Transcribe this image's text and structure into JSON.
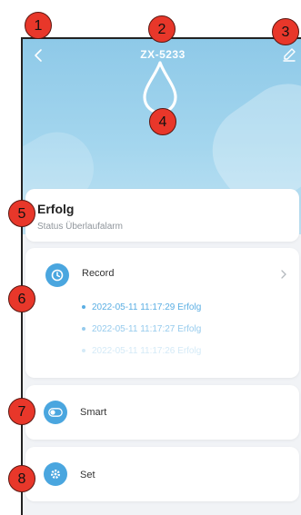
{
  "header": {
    "title": "ZX-5233"
  },
  "status": {
    "title": "Erfolg",
    "subtitle": "Status Überlaufalarm"
  },
  "record": {
    "label": "Record",
    "items": [
      {
        "text": "2022-05-11 11:17:29 Erfolg",
        "color": "#5aaee3"
      },
      {
        "text": "2022-05-11 11:17:27 Erfolg",
        "color": "#96cbed"
      },
      {
        "text": "2022-05-11 11:17:26 Erfolg",
        "color": "#d4eaf7"
      }
    ]
  },
  "smart": {
    "label": "Smart"
  },
  "settings": {
    "label": "Set"
  },
  "annotations": [
    "1",
    "2",
    "3",
    "4",
    "5",
    "6",
    "7",
    "8"
  ],
  "colors": {
    "accent": "#4aa6df",
    "marker": "#e8372a",
    "hero_top": "#8ec9e8"
  },
  "icons": {
    "back": "chevron-left-icon",
    "edit": "pencil-icon",
    "hero": "water-drop-icon",
    "record": "clock-icon",
    "smart": "toggle-icon",
    "settings": "gear-icon",
    "chevron": "chevron-right-icon"
  }
}
